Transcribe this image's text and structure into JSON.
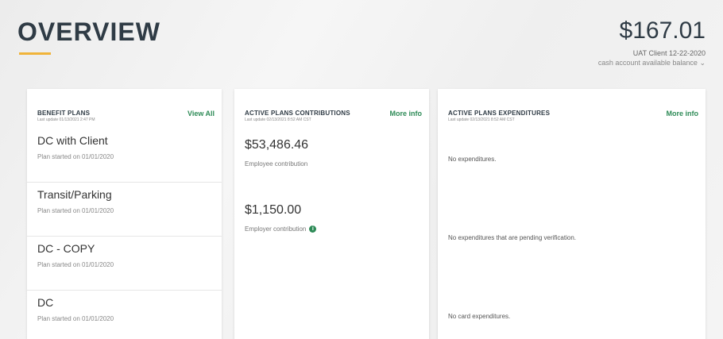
{
  "header": {
    "title": "OVERVIEW",
    "balance": "$167.01",
    "client": "UAT Client 12-22-2020",
    "balance_label": "cash account available balance"
  },
  "colors": {
    "accent": "#f0b43a",
    "link": "#2e8b57",
    "title": "#2f3b45"
  },
  "icons": {
    "balance_toggle": "chevron-down-icon",
    "employer_info": "info-icon"
  },
  "benefit_plans": {
    "title": "BENEFIT PLANS",
    "last_update": "Last update 01/13/2021 2:47 PM",
    "link": "View All",
    "items": [
      {
        "name": "DC with Client",
        "date": "Plan started on 01/01/2020"
      },
      {
        "name": "Transit/Parking",
        "date": "Plan started on 01/01/2020"
      },
      {
        "name": "DC - COPY",
        "date": "Plan started on 01/01/2020"
      },
      {
        "name": "DC",
        "date": "Plan started on 01/01/2020"
      }
    ]
  },
  "contributions": {
    "title": "ACTIVE PLANS CONTRIBUTIONS",
    "last_update": "Last update 02/13/2021 8:52 AM CST",
    "link": "More info",
    "employee_amount": "$53,486.46",
    "employee_label": "Employee contribution",
    "employer_amount": "$1,150.00",
    "employer_label": "Employer contribution"
  },
  "expenditures": {
    "title": "ACTIVE PLANS EXPENDITURES",
    "last_update": "Last update 02/13/2021 8:52 AM CST",
    "link": "More info",
    "none": "No expenditures.",
    "pending": "No expenditures that are pending verification.",
    "card": "No card expenditures."
  }
}
